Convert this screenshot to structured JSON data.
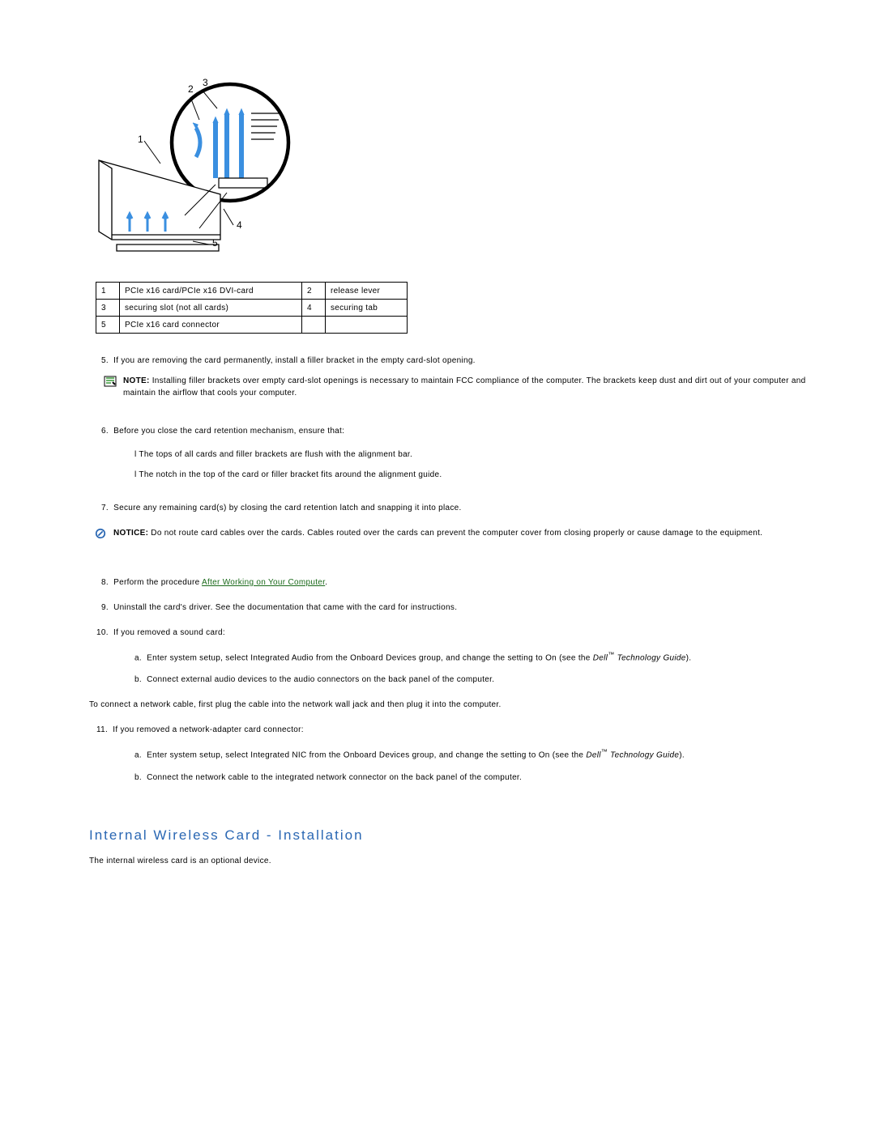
{
  "legend": {
    "r1c1n": "1",
    "r1c1": "PCIe x16 card/PCIe x16 DVI-card",
    "r1c2n": "2",
    "r1c2": "release lever",
    "r2c1n": "3",
    "r2c1": "securing slot (not all cards)",
    "r2c2n": "4",
    "r2c2": "securing tab",
    "r3c1n": "5",
    "r3c1": "PCIe x16 card connector"
  },
  "step5n": "5.",
  "step5": "If you are removing the card permanently, install a filler bracket in the empty card-slot opening.",
  "noteLabel": "NOTE:",
  "noteText": " Installing filler brackets over empty card-slot openings is necessary to maintain FCC compliance of the computer. The brackets keep dust and dirt out of your computer and maintain the airflow that cools your computer.",
  "step6n": "6.",
  "step6": "Before you close the card retention mechanism, ensure that:",
  "step6a": "The tops of all cards and filler brackets are flush with the alignment bar.",
  "step6b": "The notch in the top of the card or filler bracket fits around the alignment guide.",
  "step7n": "7.",
  "step7": "Secure any remaining card(s) by closing the card retention latch and snapping it into place.",
  "noticeLabel": "NOTICE:",
  "noticeText": " Do not route card cables over the cards. Cables routed over the cards can prevent the computer cover from closing properly or cause damage to the equipment.",
  "step8n": "8.",
  "step8a": "Perform the procedure ",
  "step8link": "After Working on Your Computer",
  "step8b": ".",
  "step9n": "9.",
  "step9": "Uninstall the card's driver. See the documentation that came with the card for instructions.",
  "step10n": "10.",
  "step10": "If you removed a sound card:",
  "s10an": "a.",
  "s10a1": "Enter system setup, select Integrated Audio from the Onboard Devices group, and change the setting to On (see the ",
  "s10a2": "Dell",
  "s10a3": "™",
  "s10a4": " Technology Guide",
  "s10a5": ").",
  "s10bn": "b.",
  "s10b": "Connect external audio devices to the audio connectors on the back panel of the computer.",
  "midPara": "To connect a network cable, first plug the cable into the network wall jack and then plug it into the computer.",
  "step11n": "11.",
  "step11": "If you removed a network-adapter card connector:",
  "s11an": "a.",
  "s11a1": "Enter system setup, select Integrated NIC from the Onboard Devices group, and change the setting to On (see the ",
  "s11a2": "Dell",
  "s11a3": "™",
  "s11a4": " Technology Guide",
  "s11a5": ").",
  "s11bn": "b.",
  "s11b": "Connect the network cable to the integrated network connector on the back panel of the computer.",
  "heading": "Internal Wireless Card - Installation",
  "afterHeading": "The internal wireless card is an optional device.",
  "bullet": "l  "
}
